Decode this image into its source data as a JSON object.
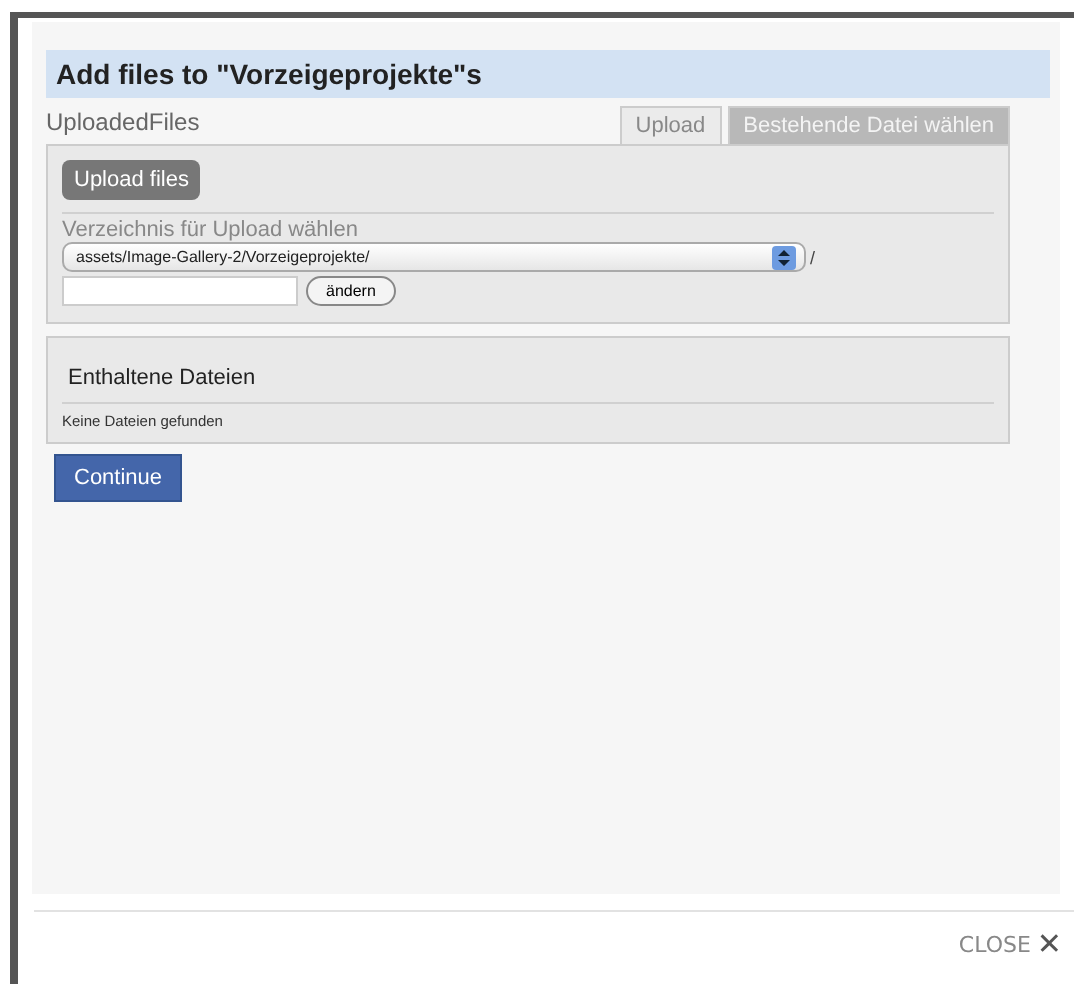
{
  "dialog": {
    "title": "Add files to \"Vorzeigeprojekte\"s"
  },
  "field_label": "UploadedFiles",
  "tabs": [
    {
      "label": "Upload",
      "selected": true
    },
    {
      "label": "Bestehende Datei wählen",
      "selected": false
    }
  ],
  "upload_button": "Upload files",
  "folder": {
    "label": "Verzeichnis für Upload wählen",
    "value": "assets/Image-Gallery-2/Vorzeigeprojekte/",
    "separator": "/",
    "change_button": "ändern"
  },
  "files": {
    "heading": "Enthaltene Dateien",
    "empty_text": "Keine Dateien gefunden"
  },
  "continue_button": "Continue",
  "close": {
    "label": "CLOSE",
    "icon": "✕"
  }
}
